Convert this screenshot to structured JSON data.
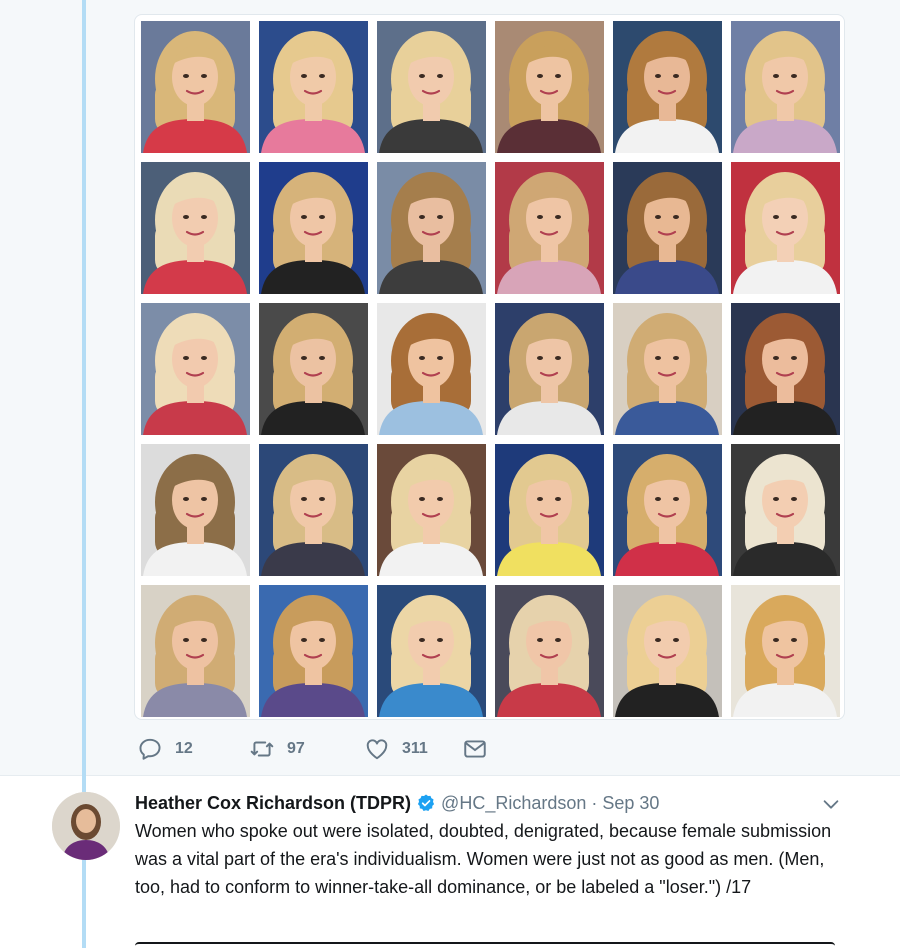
{
  "media": {
    "photos": [
      {
        "bg": "#6a7a9a",
        "hair": "#d9b779",
        "skin": "#efc6a4",
        "top": "#d63a48"
      },
      {
        "bg": "#2c4c8c",
        "hair": "#e6c98e",
        "skin": "#f0caa8",
        "top": "#e77a9c"
      },
      {
        "bg": "#5d6f8a",
        "hair": "#e8d09a",
        "skin": "#f1cbae",
        "top": "#3a3a3a"
      },
      {
        "bg": "#a98a74",
        "hair": "#c9a05c",
        "skin": "#eec4a2",
        "top": "#5a2f36"
      },
      {
        "bg": "#2d4a6e",
        "hair": "#b07a3e",
        "skin": "#e8b896",
        "top": "#f2f2f2"
      },
      {
        "bg": "#6f7fa5",
        "hair": "#e2c48a",
        "skin": "#f0c8a8",
        "top": "#c9a8c8"
      },
      {
        "bg": "#4c5f78",
        "hair": "#eadbb6",
        "skin": "#f2ccb0",
        "top": "#d33a4a"
      },
      {
        "bg": "#1f3d8c",
        "hair": "#d6b37a",
        "skin": "#efc6a6",
        "top": "#222222"
      },
      {
        "bg": "#7a8ca6",
        "hair": "#a57e4c",
        "skin": "#e9bea0",
        "top": "#3d3d3d"
      },
      {
        "bg": "#b23a48",
        "hair": "#cfa774",
        "skin": "#efc5a5",
        "top": "#d8a4b8"
      },
      {
        "bg": "#2a3a58",
        "hair": "#9a6a3a",
        "skin": "#e8b893",
        "top": "#3a4a8a"
      },
      {
        "bg": "#c0313f",
        "hair": "#e8cf9c",
        "skin": "#f3d0b6",
        "top": "#f2f2f2"
      },
      {
        "bg": "#7c8da8",
        "hair": "#eedcb8",
        "skin": "#f2caae",
        "top": "#c83a4a"
      },
      {
        "bg": "#4a4a4a",
        "hair": "#d2ae72",
        "skin": "#ecc2a2",
        "top": "#222222"
      },
      {
        "bg": "#e8e8e8",
        "hair": "#a86e38",
        "skin": "#efc3a0",
        "top": "#9cc0e0"
      },
      {
        "bg": "#2d3f6a",
        "hair": "#c9a670",
        "skin": "#eec5a6",
        "top": "#e8e8e8"
      },
      {
        "bg": "#d8cfc2",
        "hair": "#d0ac74",
        "skin": "#eec2a0",
        "top": "#3a5a9a"
      },
      {
        "bg": "#2a3550",
        "hair": "#9c5a34",
        "skin": "#ecbc9c",
        "top": "#222222"
      },
      {
        "bg": "#dcdcdc",
        "hair": "#8c6e48",
        "skin": "#eec4a4",
        "top": "#f2f2f2"
      },
      {
        "bg": "#2c4878",
        "hair": "#d8bc86",
        "skin": "#f0c8a8",
        "top": "#3a3a4a"
      },
      {
        "bg": "#6a4a3a",
        "hair": "#e8d3a2",
        "skin": "#f2cbac",
        "top": "#f2f2f2"
      },
      {
        "bg": "#1e3a7a",
        "hair": "#e2c990",
        "skin": "#f0c6a6",
        "top": "#f0e060"
      },
      {
        "bg": "#2e4a7a",
        "hair": "#d6ae6c",
        "skin": "#efc4a4",
        "top": "#d03048"
      },
      {
        "bg": "#3a3a3a",
        "hair": "#ece4d0",
        "skin": "#f3ceb2",
        "top": "#2a2a2a"
      },
      {
        "bg": "#d8d2c6",
        "hair": "#d0ac74",
        "skin": "#eec2a2",
        "top": "#8a8aa8"
      },
      {
        "bg": "#3a6ab0",
        "hair": "#c89c5c",
        "skin": "#efc4a2",
        "top": "#5a4a8a"
      },
      {
        "bg": "#2a4a7a",
        "hair": "#ecd6a6",
        "skin": "#f2ccae",
        "top": "#3a8acc"
      },
      {
        "bg": "#4a4a5a",
        "hair": "#e6d2ac",
        "skin": "#f0c6a8",
        "top": "#c83a48"
      },
      {
        "bg": "#c4c0ba",
        "hair": "#eccf94",
        "skin": "#f2ccae",
        "top": "#222222"
      },
      {
        "bg": "#e8e4da",
        "hair": "#d9a95c",
        "skin": "#efc4a0",
        "top": "#f2f2f2"
      }
    ]
  },
  "actions": {
    "reply_count": "12",
    "retweet_count": "97",
    "like_count": "311"
  },
  "tweet": {
    "name": "Heather Cox Richardson (TDPR)",
    "handle": "@HC_Richardson",
    "separator": "·",
    "date": "Sep 30",
    "text": "Women who spoke out were isolated, doubted, denigrated, because female submission was a vital part of the era's individualism. Women were just not as good as men. (Men, too, had to conform to winner-take-all dominance, or be labeled a \"loser.\") /17"
  },
  "colors": {
    "accent": "#1da1f2",
    "muted": "#657786",
    "thread_line": "#b3dcf5"
  },
  "icons": {
    "reply": "reply-icon",
    "retweet": "retweet-icon",
    "like": "heart-icon",
    "dm": "envelope-icon",
    "verified": "verified-badge-icon",
    "caret": "chevron-down-icon"
  }
}
